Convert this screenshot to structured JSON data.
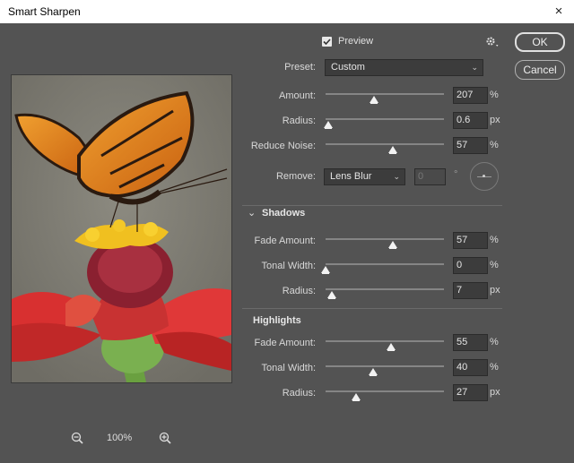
{
  "window": {
    "title": "Smart Sharpen",
    "close_glyph": "×"
  },
  "buttons": {
    "ok": "OK",
    "cancel": "Cancel"
  },
  "preview": {
    "label": "Preview",
    "checked": true
  },
  "preset": {
    "label": "Preset:",
    "value": "Custom"
  },
  "main": {
    "amount": {
      "label": "Amount:",
      "value": "207",
      "unit": "%",
      "level": 0.41
    },
    "radius": {
      "label": "Radius:",
      "value": "0.6",
      "unit": "px",
      "level": 0.02
    },
    "reduce_noise": {
      "label": "Reduce Noise:",
      "value": "57",
      "unit": "%",
      "level": 0.57
    },
    "remove": {
      "label": "Remove:",
      "value": "Lens Blur",
      "angle": "0",
      "degree_symbol": "°"
    }
  },
  "shadows": {
    "title": "Shadows",
    "fade_amount": {
      "label": "Fade Amount:",
      "value": "57",
      "unit": "%",
      "level": 0.57
    },
    "tonal_width": {
      "label": "Tonal Width:",
      "value": "0",
      "unit": "%",
      "level": 0.0
    },
    "radius": {
      "label": "Radius:",
      "value": "7",
      "unit": "px",
      "level": 0.05
    }
  },
  "highlights": {
    "title": "Highlights",
    "fade_amount": {
      "label": "Fade Amount:",
      "value": "55",
      "unit": "%",
      "level": 0.55
    },
    "tonal_width": {
      "label": "Tonal Width:",
      "value": "40",
      "unit": "%",
      "level": 0.4
    },
    "radius": {
      "label": "Radius:",
      "value": "27",
      "unit": "px",
      "level": 0.26
    }
  },
  "zoom": {
    "level": "100%"
  },
  "colors": {
    "background": "#535353",
    "field": "#3c3c3c",
    "track": "#858585"
  }
}
